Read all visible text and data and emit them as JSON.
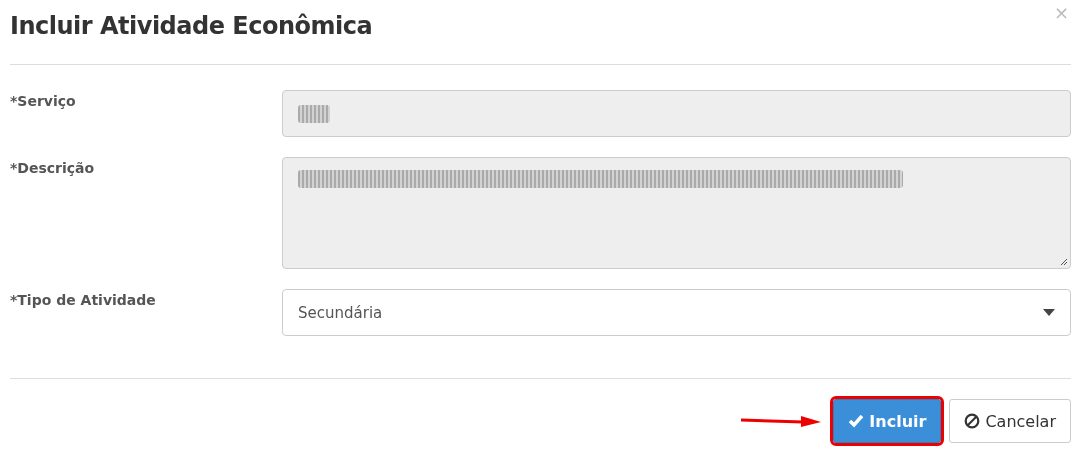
{
  "dialog": {
    "title": "Incluir Atividade Econômica",
    "close": "×"
  },
  "fields": [
    {
      "kind": "input",
      "label": "*Serviço",
      "disabled": true,
      "redacted": true
    },
    {
      "kind": "textarea",
      "label": "*Descrição",
      "disabled": true,
      "redacted": true
    },
    {
      "kind": "select",
      "label": "*Tipo de Atividade",
      "disabled": false,
      "value": "Secundária"
    }
  ],
  "buttons": [
    {
      "kind": "primary",
      "label": "Incluir",
      "highlighted": true
    },
    {
      "kind": "cancel",
      "label": "Cancelar",
      "highlighted": false
    }
  ]
}
